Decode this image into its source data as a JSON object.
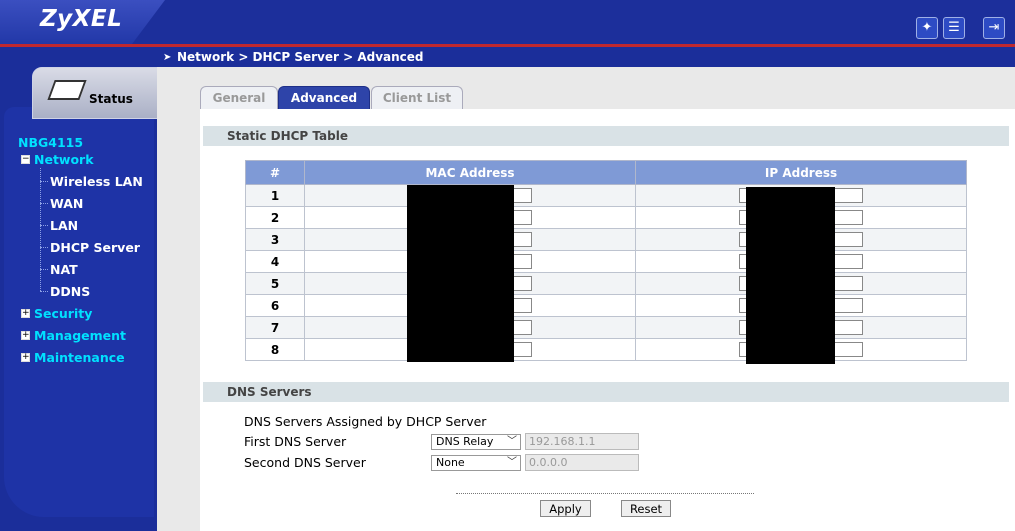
{
  "brand": {
    "logo_text": "ZyXEL"
  },
  "header_icons": [
    "wizard-icon",
    "logout-icon"
  ],
  "breadcrumb": {
    "path": "Network > DHCP Server > Advanced"
  },
  "sidebar": {
    "status_tab": "Status",
    "device": "NBG4115",
    "network": "Network",
    "network_items": [
      "Wireless LAN",
      "WAN",
      "LAN",
      "DHCP Server",
      "NAT",
      "DDNS"
    ],
    "other_sections": [
      "Security",
      "Management",
      "Maintenance"
    ]
  },
  "tabs": [
    {
      "label": "General",
      "active": false
    },
    {
      "label": "Advanced",
      "active": true
    },
    {
      "label": "Client List",
      "active": false
    }
  ],
  "static_dhcp": {
    "title": "Static DHCP Table",
    "columns": [
      "#",
      "MAC Address",
      "IP Address"
    ],
    "rows": [
      "1",
      "2",
      "3",
      "4",
      "5",
      "6",
      "7",
      "8"
    ]
  },
  "dns": {
    "title": "DNS Servers",
    "subtitle": "DNS Servers Assigned by DHCP Server",
    "first_label": "First DNS Server",
    "first_mode": "DNS Relay",
    "first_ip": "192.168.1.1",
    "second_label": "Second DNS Server",
    "second_mode": "None",
    "second_ip": "0.0.0.0"
  },
  "buttons": {
    "apply": "Apply",
    "reset": "Reset"
  },
  "colors": {
    "nav_blue": "#1b2e9a",
    "accent_red": "#c0282f",
    "active_tab": "#2e44a9",
    "nav_highlight": "#00e1ff"
  }
}
